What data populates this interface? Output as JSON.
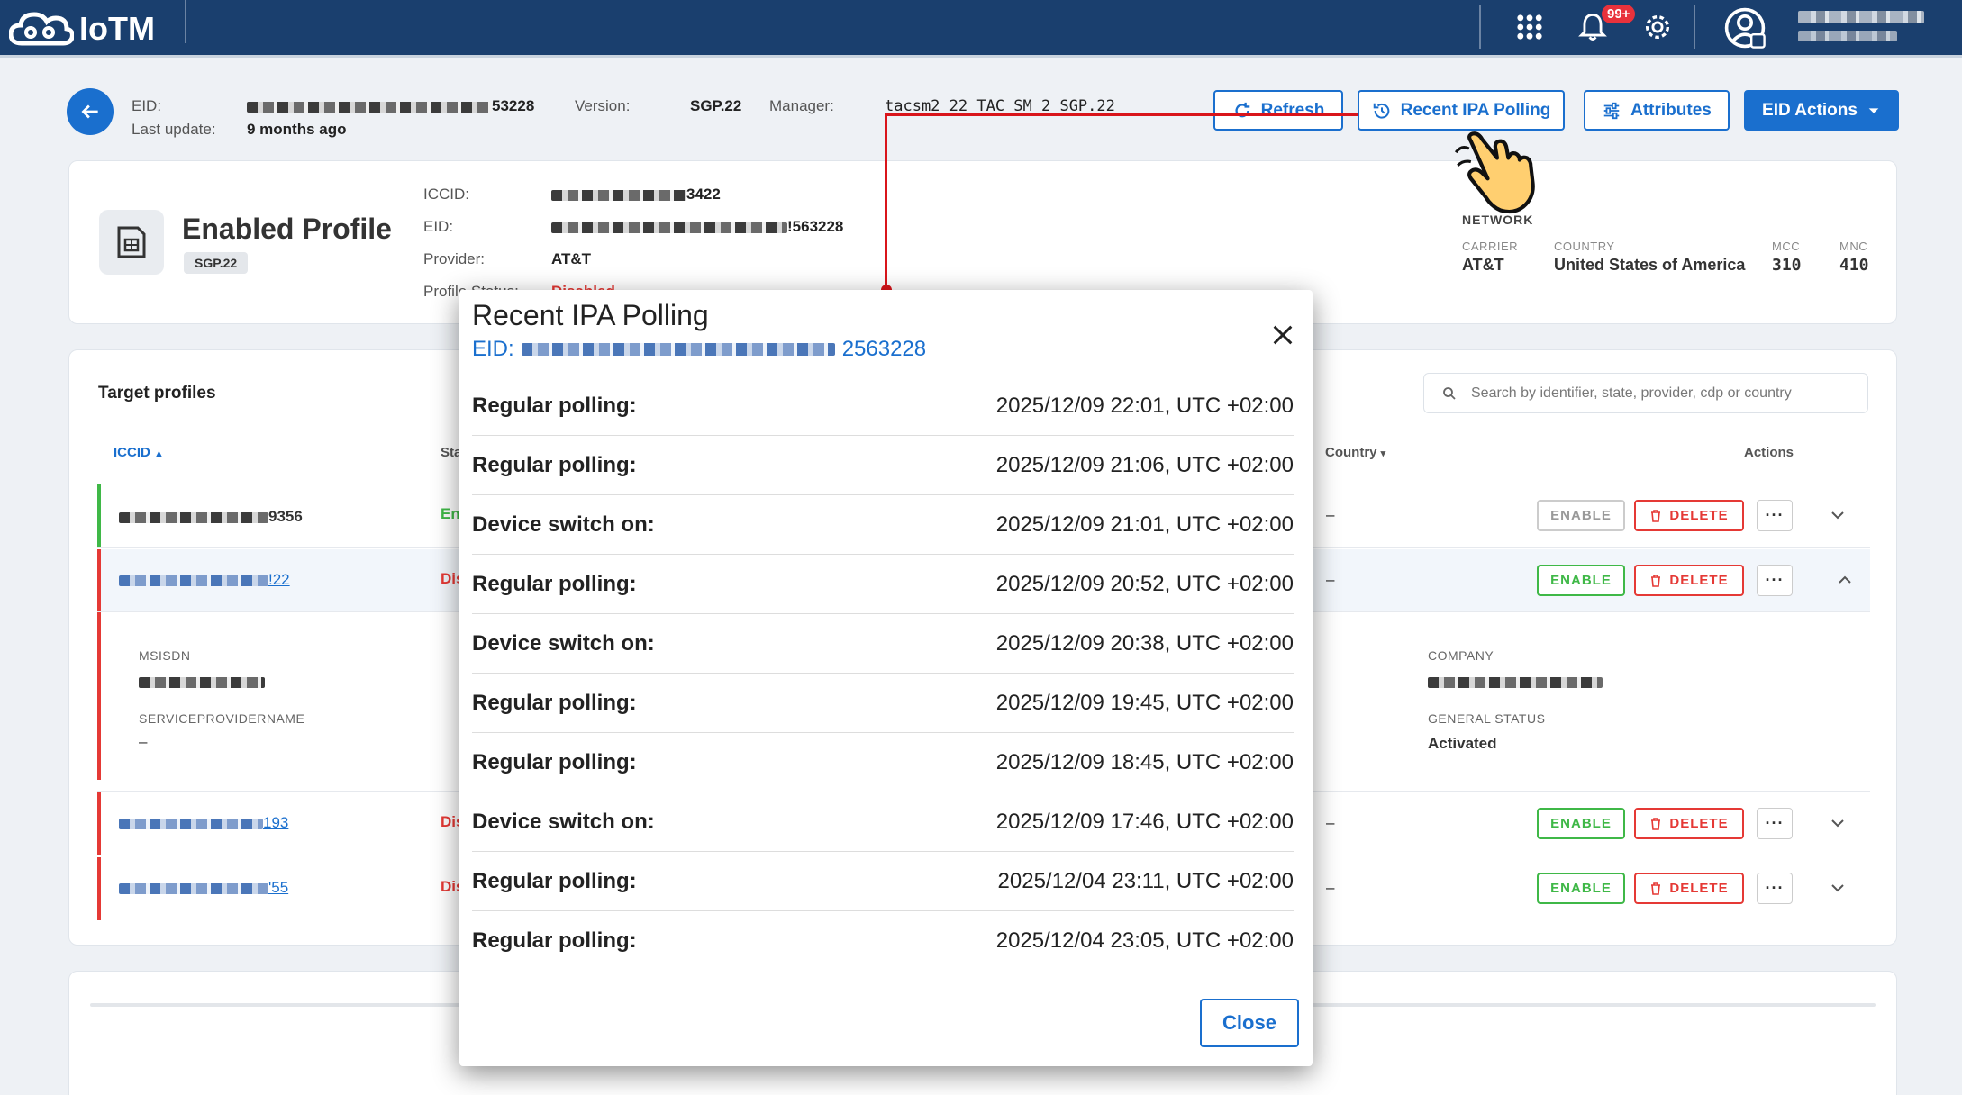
{
  "app": {
    "logo_text": "IoTM",
    "notification_count": "99+"
  },
  "header": {
    "eid_label": "EID:",
    "eid_value_visible": "53228",
    "last_update_label": "Last update:",
    "last_update_value": "9 months ago",
    "version_label": "Version:",
    "version_value": "SGP.22",
    "manager_label": "Manager:",
    "manager_value": "tacsm2 22 TAC SM 2 SGP.22",
    "buttons": {
      "refresh": "Refresh",
      "recent_ipa": "Recent IPA Polling",
      "attributes": "Attributes",
      "eid_actions": "EID Actions"
    }
  },
  "profile_card": {
    "title": "Enabled Profile",
    "chip": "SGP.22",
    "iccid_label": "ICCID:",
    "iccid_visible": "3422",
    "eid_label": "EID:",
    "eid_visible": "!563228",
    "provider_label": "Provider:",
    "provider_value": "AT&T",
    "profile_status_label": "Profile Status:",
    "profile_status_value": "Disabled",
    "network": {
      "heading": "NETWORK",
      "carrier_label": "CARRIER",
      "carrier_value": "AT&T",
      "country_label": "COUNTRY",
      "country_value": "United States of America",
      "mcc_label": "MCC",
      "mcc_value": "310",
      "mnc_label": "MNC",
      "mnc_value": "410"
    }
  },
  "targets": {
    "title": "Target profiles",
    "search_placeholder": "Search by identifier, state, provider, cdp or country",
    "columns": {
      "iccid": "ICCID",
      "state": "Sta",
      "country": "Country",
      "actions": "Actions"
    },
    "rows": [
      {
        "iccid_visible": "9356",
        "state": "En",
        "country": "–"
      },
      {
        "iccid_visible": "!22",
        "state": "Dis",
        "country": "–"
      },
      {
        "iccid_visible": "193",
        "state": "Dis",
        "country": "–"
      },
      {
        "iccid_visible": "'55",
        "state": "Dis",
        "country": "–"
      }
    ],
    "action_labels": {
      "enable": "ENABLE",
      "delete": "DELETE",
      "more": "···"
    },
    "expanded": {
      "msisdn_label": "MSISDN",
      "spn_label": "SERVICEPROVIDERNAME",
      "spn_value": "–",
      "company_label": "COMPANY",
      "general_status_label": "GENERAL STATUS",
      "general_status_value": "Activated"
    }
  },
  "modal": {
    "title": "Recent IPA Polling",
    "eid_label": "EID:",
    "eid_visible": "2563228",
    "close_label": "Close",
    "rows": [
      {
        "type": "Regular polling:",
        "time": "2025/12/09 22:01, UTC +02:00"
      },
      {
        "type": "Regular polling:",
        "time": "2025/12/09 21:06, UTC +02:00"
      },
      {
        "type": "Device switch on:",
        "time": "2025/12/09 21:01, UTC +02:00"
      },
      {
        "type": "Regular polling:",
        "time": "2025/12/09 20:52, UTC +02:00"
      },
      {
        "type": "Device switch on:",
        "time": "2025/12/09 20:38, UTC +02:00"
      },
      {
        "type": "Regular polling:",
        "time": "2025/12/09 19:45, UTC +02:00"
      },
      {
        "type": "Regular polling:",
        "time": "2025/12/09 18:45, UTC +02:00"
      },
      {
        "type": "Device switch on:",
        "time": "2025/12/09 17:46, UTC +02:00"
      },
      {
        "type": "Regular polling:",
        "time": "2025/12/04 23:11, UTC +02:00"
      },
      {
        "type": "Regular polling:",
        "time": "2025/12/04 23:05, UTC +02:00"
      }
    ]
  },
  "colors": {
    "brand": "#1a3f6e",
    "accent": "#1a6fce",
    "enable": "#3fb847",
    "danger": "#e53935",
    "annotation": "#d9151b"
  }
}
